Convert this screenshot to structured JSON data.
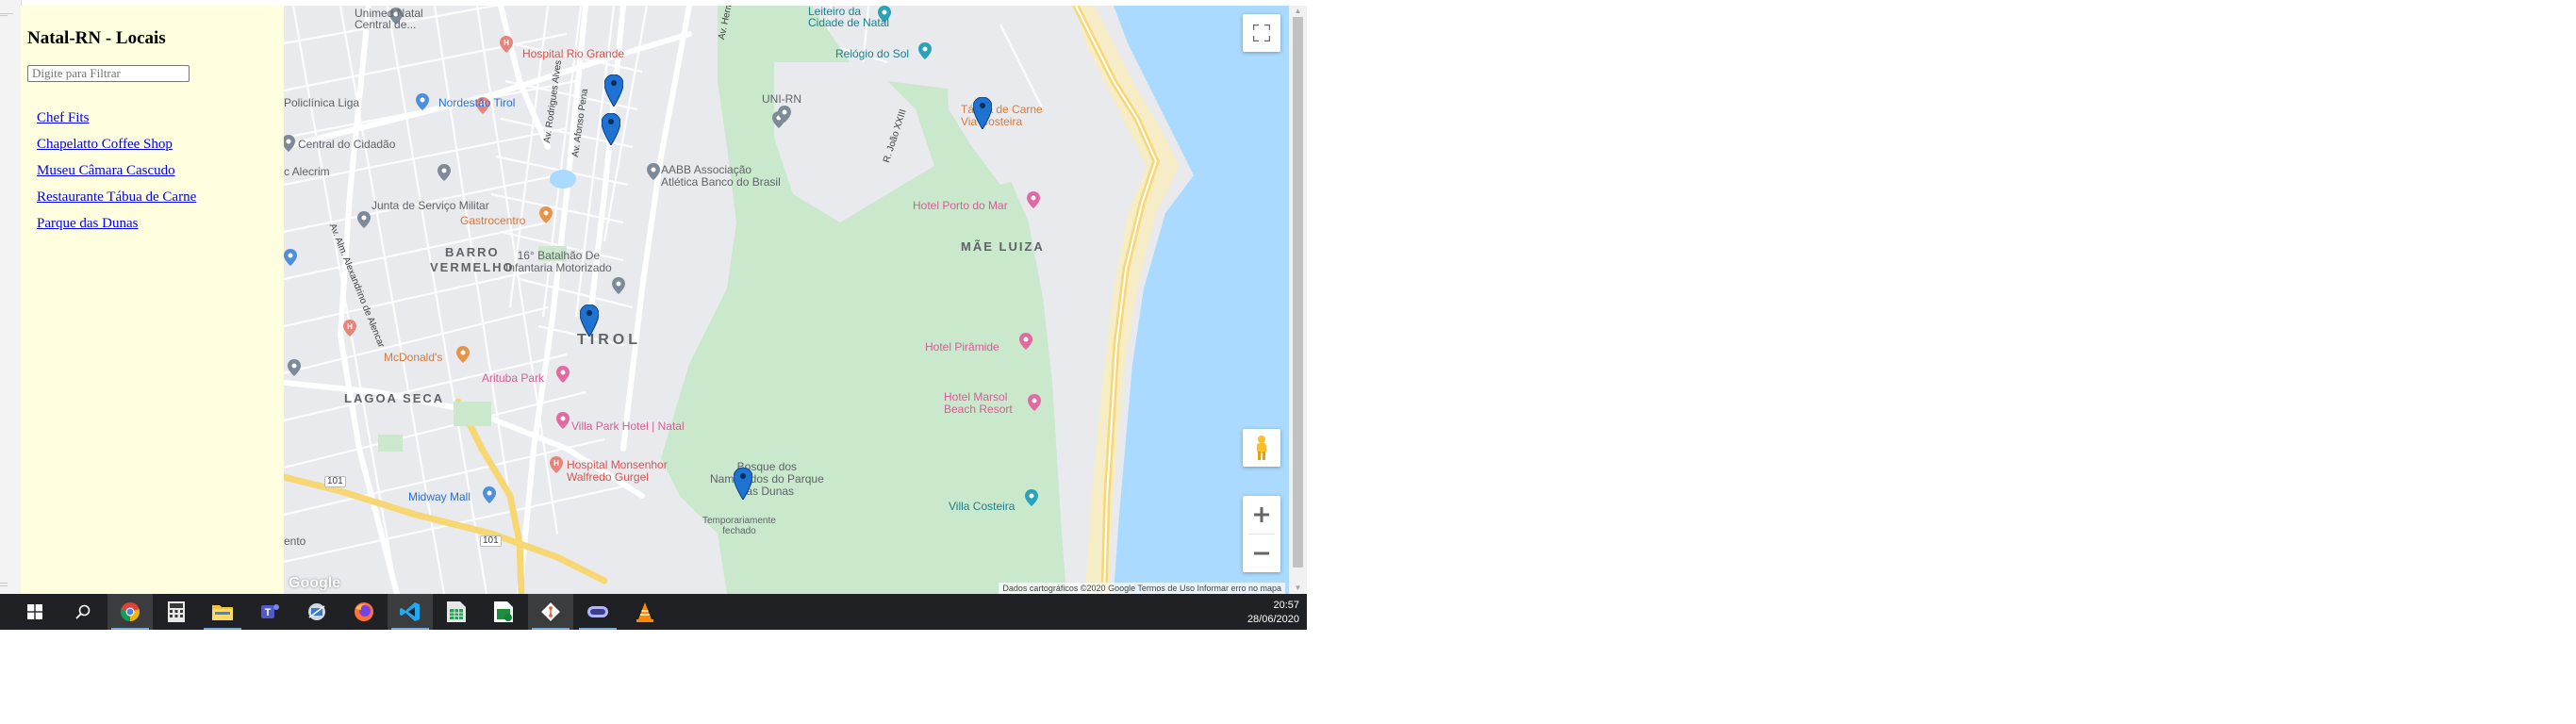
{
  "sidebar": {
    "title": "Natal-RN - Locais",
    "filter_placeholder": "Digite para Filtrar",
    "places": [
      "Chef Fits",
      "Chapelatto Coffee Shop",
      "Museu Câmara Cascudo",
      "Restaurante Tábua de Carne",
      "Parque das Dunas"
    ]
  },
  "map": {
    "labels": {
      "unimed": "Unimed Natal\nCentral de...",
      "leiteiro": "Leiteiro da\nCidade de Natal",
      "relogio": "Relógio do Sol",
      "hospital_rio_grande": "Hospital Rio Grande",
      "policlinica": "Policlínica Liga",
      "nordestao": "Nordestão Tirol",
      "uni_rn": "UNI-RN",
      "tabua": "Tábua de Carne\nVia Costeira",
      "centro_cidadao": "Central do Cidadão",
      "alecrim": "c Alecrim",
      "aabb": "AABB Associação\nAtlética Banco do Brasil",
      "junta": "Junta de Serviço Militar",
      "gastrocentro": "Gastrocentro",
      "hotel_porto_mar": "Hotel Porto do Mar",
      "barro_vermelho": "BARRO\nVERMELHO",
      "batalhao": "16° Batalhão De\nInfantaria Motorizado",
      "mae_luiza": "MÃE LUIZA",
      "tirol": "TIROL",
      "mcdonalds": "McDonald's",
      "hotel_piramide": "Hotel Pirâmide",
      "arituba": "Arituba Park",
      "lagoa_seca": "LAGOA SECA",
      "hotel_marsol": "Hotel Marsol\nBeach Resort",
      "villa_park": "Villa Park Hotel | Natal",
      "hospital_monsenhor": "Hospital Monsenhor\nWalfredo Gurgel",
      "bosque": "Bosque dos\nNamorados do Parque\ndas Dunas",
      "temporariamente": "Temporariamente\nfechado",
      "midway": "Midway Mall",
      "villa_costeira": "Villa Costeira",
      "ento": "ento",
      "road_101a": "101",
      "road_101b": "101",
      "av_rodrigues": "Av. Rodrigues Alves",
      "av_afonso_pena": "Av. Afonso Pena",
      "av_alm": "Av. Alm. Alexandrino de Alencar",
      "rua_joao": "R. João XXIII",
      "av_hermes": "Av. Herm"
    },
    "google": "Google",
    "attribution": "Dados cartográficos ©2020 Google   Termos de Uso   Informar erro no mapa"
  },
  "taskbar": {
    "apps": [
      "start",
      "search",
      "chrome",
      "calculator",
      "file-explorer",
      "teams",
      "remote-desktop",
      "firefox",
      "vscode",
      "spreadsheet",
      "spreadsheet-2",
      "git",
      "terminal",
      "vlc"
    ],
    "time": "20:57",
    "date": "28/06/2020"
  },
  "colors": {
    "sidebar_bg": "#ffffe0",
    "link": "#0000ee",
    "water": "#aadaff",
    "park": "#c8e6c9",
    "marker": "#1e73d2"
  }
}
